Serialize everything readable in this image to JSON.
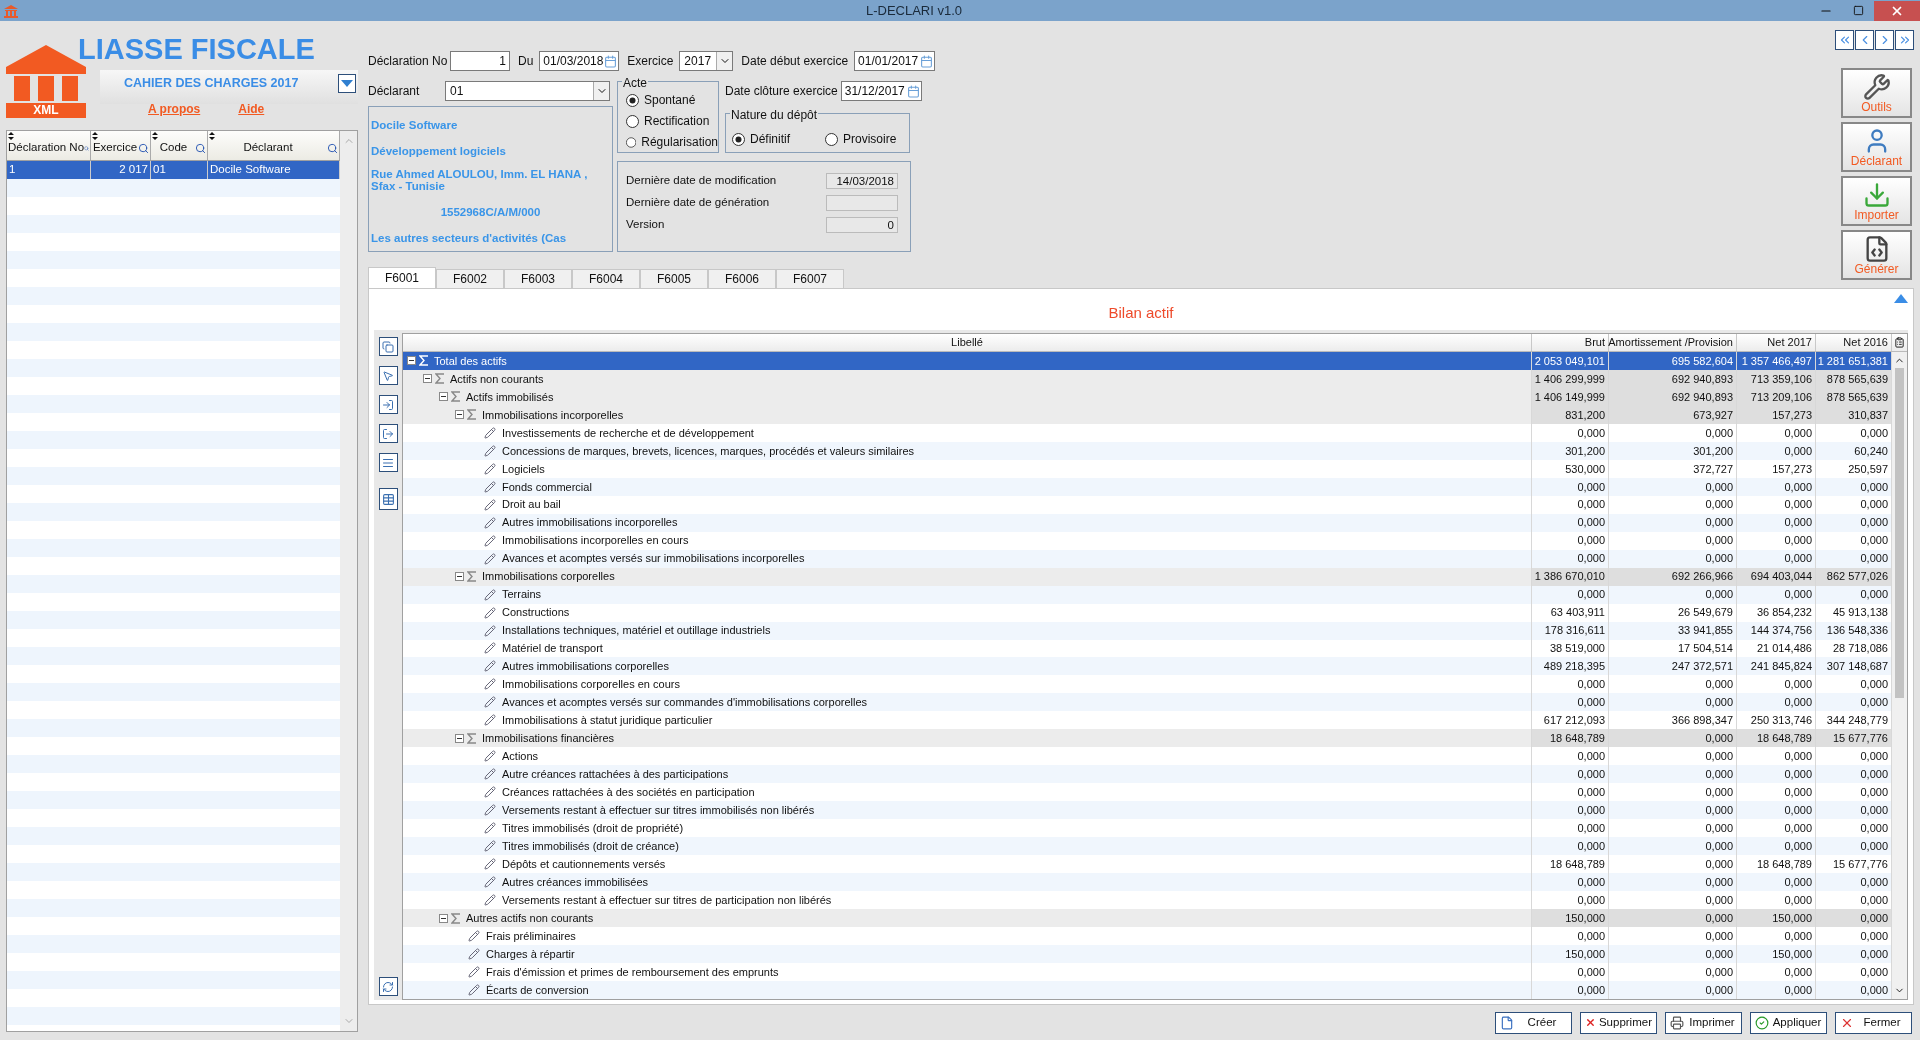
{
  "window": {
    "title": "L-DECLARI v1.0"
  },
  "logo": {
    "title": "LIASSE FISCALE",
    "badge": "XML"
  },
  "edition": {
    "label": "CAHIER DES CHARGES 2017"
  },
  "links": [
    "A propos",
    "Aide"
  ],
  "declarations_table": {
    "columns": [
      "Déclaration No",
      "Exercice",
      "Code",
      "Déclarant"
    ],
    "rows": [
      {
        "cells": [
          "1",
          "2 017",
          "01",
          "Docile Software"
        ],
        "selected": true
      }
    ]
  },
  "form": {
    "declaration_no": {
      "label": "Déclaration No",
      "value": "1"
    },
    "du": {
      "label": "Du",
      "value": "01/03/2018"
    },
    "exercice": {
      "label": "Exercice",
      "value": "2017"
    },
    "date_debut": {
      "label": "Date début exercice",
      "value": "01/01/2017"
    },
    "declarant": {
      "label": "Déclarant",
      "value": "01"
    },
    "date_cloture": {
      "label": "Date clôture exercice",
      "value": "31/12/2017"
    }
  },
  "declarant_info": [
    "Docile Software",
    "Développement logiciels",
    "Rue Ahmed ALOULOU, Imm. EL HANA , Sfax - Tunisie",
    "1552968C/A/M/000",
    "Les autres secteurs d'activités (Cas"
  ],
  "acte": {
    "title": "Acte",
    "options": [
      {
        "label": "Spontané",
        "selected": true
      },
      {
        "label": "Rectification",
        "selected": false
      },
      {
        "label": "Régularisation",
        "selected": false
      }
    ]
  },
  "nature_depot": {
    "title": "Nature du dépôt",
    "options": [
      {
        "label": "Définitif",
        "selected": true
      },
      {
        "label": "Provisoire",
        "selected": false
      }
    ]
  },
  "status": [
    {
      "label": "Dernière date de modification",
      "value": "14/03/2018"
    },
    {
      "label": "Dernière date de génération"
    },
    {
      "label": "Version",
      "value": "0"
    }
  ],
  "side_buttons": [
    {
      "label": "Outils",
      "kind": "tools"
    },
    {
      "label": "Déclarant",
      "kind": "user"
    },
    {
      "label": "Importer",
      "kind": "import"
    },
    {
      "label": "Générer",
      "kind": "xml"
    }
  ],
  "tabs": [
    {
      "label": "F6001",
      "selected": true
    },
    {
      "label": "F6002",
      "selected": false
    },
    {
      "label": "F6003",
      "selected": false
    },
    {
      "label": "F6004",
      "selected": false
    },
    {
      "label": "F6005",
      "selected": false
    },
    {
      "label": "F6006",
      "selected": false
    },
    {
      "label": "F6007",
      "selected": false
    }
  ],
  "section_title": "Bilan actif",
  "table": {
    "columns": [
      "Libellé",
      "Brut",
      "Amortissement /Provision",
      "Net 2017",
      "Net 2016"
    ],
    "rows": [
      {
        "kind": "sum",
        "label": "Total des actifs",
        "values": [
          "2 053 049,101",
          "695 582,604",
          "1 357 466,497",
          "1 281 651,381"
        ],
        "expanded": true,
        "selected": true,
        "children": [
          {
            "kind": "sum",
            "label": "Actifs non courants",
            "values": [
              "1 406 299,999",
              "692 940,893",
              "713 359,106",
              "878 565,639"
            ],
            "expanded": true,
            "selected": false,
            "children": [
              {
                "kind": "sum",
                "label": "Actifs immobilisés",
                "values": [
                  "1 406 149,999",
                  "692 940,893",
                  "713 209,106",
                  "878 565,639"
                ],
                "expanded": true,
                "selected": false,
                "children": [
                  {
                    "kind": "sum",
                    "label": "Immobilisations incorporelles",
                    "values": [
                      "831,200",
                      "673,927",
                      "157,273",
                      "310,837"
                    ],
                    "expanded": true,
                    "selected": false,
                    "children": [
                      {
                        "kind": "leaf",
                        "label": "Investissements de recherche et de développement",
                        "values": [
                          "0,000",
                          "0,000",
                          "0,000",
                          "0,000"
                        ],
                        "selected": false
                      },
                      {
                        "kind": "leaf",
                        "label": "Concessions de marques, brevets, licences, marques, procédés et valeurs similaires",
                        "values": [
                          "301,200",
                          "301,200",
                          "0,000",
                          "60,240"
                        ],
                        "selected": false
                      },
                      {
                        "kind": "leaf",
                        "label": "Logiciels",
                        "values": [
                          "530,000",
                          "372,727",
                          "157,273",
                          "250,597"
                        ],
                        "selected": false
                      },
                      {
                        "kind": "leaf",
                        "label": "Fonds commercial",
                        "values": [
                          "0,000",
                          "0,000",
                          "0,000",
                          "0,000"
                        ],
                        "selected": false
                      },
                      {
                        "kind": "leaf",
                        "label": "Droit au bail",
                        "values": [
                          "0,000",
                          "0,000",
                          "0,000",
                          "0,000"
                        ],
                        "selected": false
                      },
                      {
                        "kind": "leaf",
                        "label": "Autres immobilisations incorporelles",
                        "values": [
                          "0,000",
                          "0,000",
                          "0,000",
                          "0,000"
                        ],
                        "selected": false
                      },
                      {
                        "kind": "leaf",
                        "label": "Immobilisations incorporelles en cours",
                        "values": [
                          "0,000",
                          "0,000",
                          "0,000",
                          "0,000"
                        ],
                        "selected": false
                      },
                      {
                        "kind": "leaf",
                        "label": "Avances et acomptes versés sur immobilisations incorporelles",
                        "values": [
                          "0,000",
                          "0,000",
                          "0,000",
                          "0,000"
                        ],
                        "selected": false
                      }
                    ]
                  },
                  {
                    "kind": "sum",
                    "label": "Immobilisations corporelles",
                    "values": [
                      "1 386 670,010",
                      "692 266,966",
                      "694 403,044",
                      "862 577,026"
                    ],
                    "expanded": true,
                    "selected": false,
                    "children": [
                      {
                        "kind": "leaf",
                        "label": "Terrains",
                        "values": [
                          "0,000",
                          "0,000",
                          "0,000",
                          "0,000"
                        ],
                        "selected": false
                      },
                      {
                        "kind": "leaf",
                        "label": "Constructions",
                        "values": [
                          "63 403,911",
                          "26 549,679",
                          "36 854,232",
                          "45 913,138"
                        ],
                        "selected": false
                      },
                      {
                        "kind": "leaf",
                        "label": "Installations techniques, matériel et outillage industriels",
                        "values": [
                          "178 316,611",
                          "33 941,855",
                          "144 374,756",
                          "136 548,336"
                        ],
                        "selected": false
                      },
                      {
                        "kind": "leaf",
                        "label": "Matériel de transport",
                        "values": [
                          "38 519,000",
                          "17 504,514",
                          "21 014,486",
                          "28 718,086"
                        ],
                        "selected": false
                      },
                      {
                        "kind": "leaf",
                        "label": "Autres immobilisations corporelles",
                        "values": [
                          "489 218,395",
                          "247 372,571",
                          "241 845,824",
                          "307 148,687"
                        ],
                        "selected": false
                      },
                      {
                        "kind": "leaf",
                        "label": "Immobilisations corporelles en cours",
                        "values": [
                          "0,000",
                          "0,000",
                          "0,000",
                          "0,000"
                        ],
                        "selected": false
                      },
                      {
                        "kind": "leaf",
                        "label": "Avances et acomptes versés sur commandes d'immobilisations corporelles",
                        "values": [
                          "0,000",
                          "0,000",
                          "0,000",
                          "0,000"
                        ],
                        "selected": false
                      },
                      {
                        "kind": "leaf",
                        "label": "Immobilisations à statut juridique particulier",
                        "values": [
                          "617 212,093",
                          "366 898,347",
                          "250 313,746",
                          "344 248,779"
                        ],
                        "selected": false
                      }
                    ]
                  },
                  {
                    "kind": "sum",
                    "label": "Immobilisations financières",
                    "values": [
                      "18 648,789",
                      "0,000",
                      "18 648,789",
                      "15 677,776"
                    ],
                    "expanded": true,
                    "selected": false,
                    "children": [
                      {
                        "kind": "leaf",
                        "label": "Actions",
                        "values": [
                          "0,000",
                          "0,000",
                          "0,000",
                          "0,000"
                        ],
                        "selected": false
                      },
                      {
                        "kind": "leaf",
                        "label": "Autre créances rattachées à des participations",
                        "values": [
                          "0,000",
                          "0,000",
                          "0,000",
                          "0,000"
                        ],
                        "selected": false
                      },
                      {
                        "kind": "leaf",
                        "label": "Créances rattachées à des sociétés en participation",
                        "values": [
                          "0,000",
                          "0,000",
                          "0,000",
                          "0,000"
                        ],
                        "selected": false
                      },
                      {
                        "kind": "leaf",
                        "label": "Versements restant à effectuer sur titres immobilisés non libérés",
                        "values": [
                          "0,000",
                          "0,000",
                          "0,000",
                          "0,000"
                        ],
                        "selected": false
                      },
                      {
                        "kind": "leaf",
                        "label": "Titres immobilisés (droit de propriété)",
                        "values": [
                          "0,000",
                          "0,000",
                          "0,000",
                          "0,000"
                        ],
                        "selected": false
                      },
                      {
                        "kind": "leaf",
                        "label": "Titres immobilisés (droit de créance)",
                        "values": [
                          "0,000",
                          "0,000",
                          "0,000",
                          "0,000"
                        ],
                        "selected": false
                      },
                      {
                        "kind": "leaf",
                        "label": "Dépôts et cautionnements versés",
                        "values": [
                          "18 648,789",
                          "0,000",
                          "18 648,789",
                          "15 677,776"
                        ],
                        "selected": false
                      },
                      {
                        "kind": "leaf",
                        "label": "Autres créances immobilisées",
                        "values": [
                          "0,000",
                          "0,000",
                          "0,000",
                          "0,000"
                        ],
                        "selected": false
                      },
                      {
                        "kind": "leaf",
                        "label": "Versements restant à effectuer sur titres de participation non libérés",
                        "values": [
                          "0,000",
                          "0,000",
                          "0,000",
                          "0,000"
                        ],
                        "selected": false
                      }
                    ]
                  }
                ]
              },
              {
                "kind": "sum",
                "label": "Autres actifs non courants",
                "values": [
                  "150,000",
                  "0,000",
                  "150,000",
                  "0,000"
                ],
                "expanded": true,
                "selected": false,
                "children": [
                  {
                    "kind": "leaf",
                    "label": "Frais préliminaires",
                    "values": [
                      "0,000",
                      "0,000",
                      "0,000",
                      "0,000"
                    ],
                    "selected": false
                  },
                  {
                    "kind": "leaf",
                    "label": "Charges à répartir",
                    "values": [
                      "150,000",
                      "0,000",
                      "150,000",
                      "0,000"
                    ],
                    "selected": false
                  },
                  {
                    "kind": "leaf",
                    "label": "Frais d'émission et primes de remboursement des emprunts",
                    "values": [
                      "0,000",
                      "0,000",
                      "0,000",
                      "0,000"
                    ],
                    "selected": false
                  },
                  {
                    "kind": "leaf",
                    "label": "Écarts de conversion",
                    "values": [
                      "0,000",
                      "0,000",
                      "0,000",
                      "0,000"
                    ],
                    "selected": false
                  }
                ]
              }
            ]
          }
        ]
      }
    ]
  },
  "bottom_buttons": [
    {
      "label": "Créer",
      "kind": "new"
    },
    {
      "label": "Supprimer",
      "kind": "delete"
    },
    {
      "label": "Imprimer",
      "kind": "print"
    },
    {
      "label": "Appliquer",
      "kind": "apply"
    },
    {
      "label": "Fermer",
      "kind": "close"
    }
  ]
}
